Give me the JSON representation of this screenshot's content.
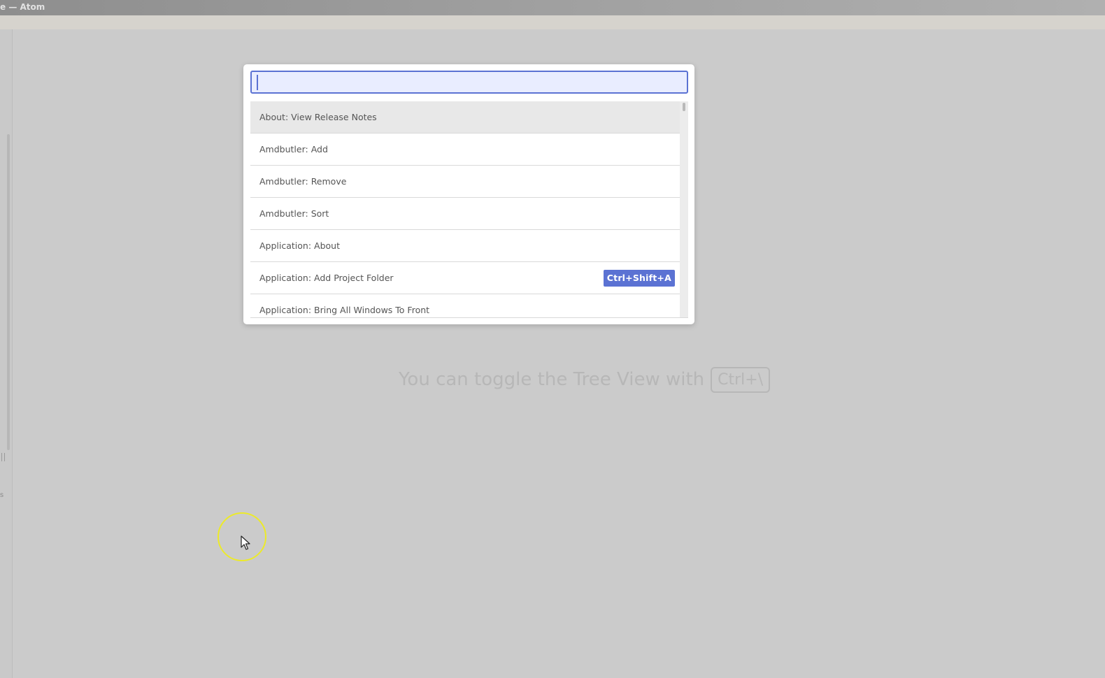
{
  "window": {
    "title": "e — Atom"
  },
  "hint": {
    "text": "You can toggle the Tree View with",
    "key": "Ctrl+\\"
  },
  "palette": {
    "input_value": "",
    "items": [
      {
        "label": "About: View Release Notes",
        "selected": true,
        "keybinding": ""
      },
      {
        "label": "Amdbutler: Add",
        "keybinding": ""
      },
      {
        "label": "Amdbutler: Remove",
        "keybinding": ""
      },
      {
        "label": "Amdbutler: Sort",
        "keybinding": ""
      },
      {
        "label": "Application: About",
        "keybinding": ""
      },
      {
        "label": "Application: Add Project Folder",
        "keybinding": "Ctrl+Shift+A"
      },
      {
        "label": "Application: Bring All Windows To Front",
        "keybinding": ""
      }
    ]
  },
  "left_dock": {
    "mark": "s"
  },
  "colors": {
    "accent": "#5b72d3",
    "input_background": "#e9edff",
    "workspace_background": "#cbcbcb",
    "cursor_highlight": "#ecea2a"
  }
}
